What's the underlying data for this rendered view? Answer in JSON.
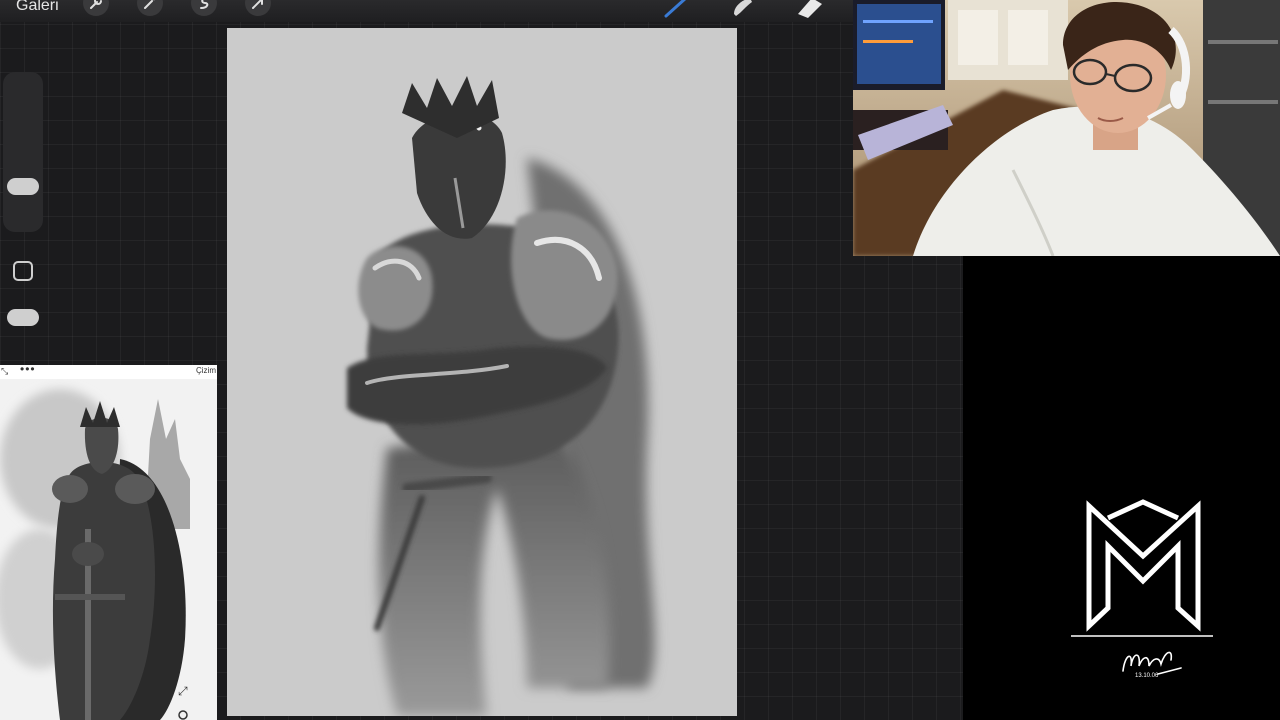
{
  "toolbar": {
    "gallery_label": "Galeri",
    "left_tools": [
      "wrench-icon",
      "magic-wand-icon",
      "selection-icon",
      "transform-arrow-icon"
    ],
    "right_tools": [
      "brush-icon",
      "smudge-icon",
      "eraser-icon"
    ],
    "brush_color": "#3a7bd5"
  },
  "reference": {
    "title": "Çizim",
    "more_label": "•••",
    "expand_icon": "expand-icon"
  },
  "branding": {
    "logo": "MM monogram",
    "signature_text": "Murat",
    "signature_date": "13.10.06"
  }
}
